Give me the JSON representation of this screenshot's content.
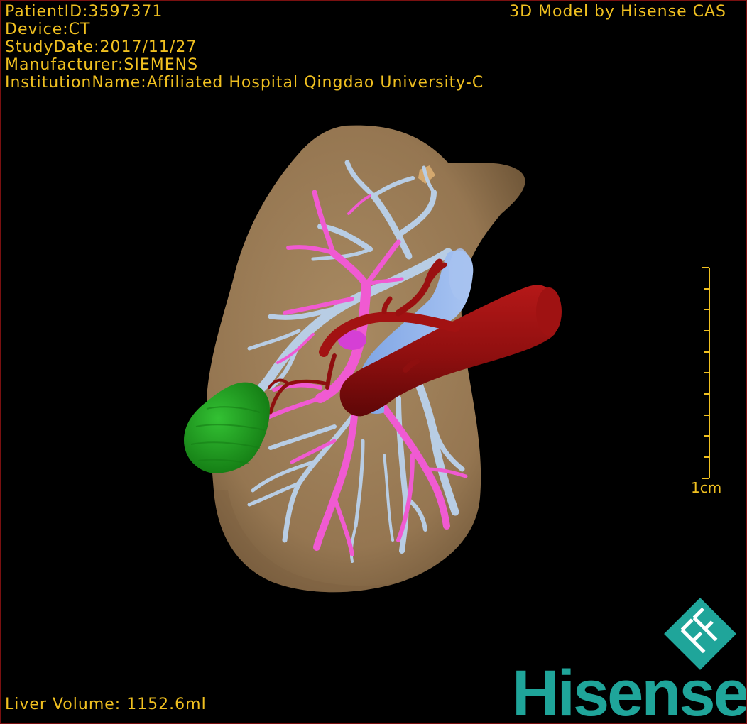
{
  "patient_info": {
    "patient_id": "PatientID:3597371",
    "device": "Device:CT",
    "study_date": "StudyDate:2017/11/27",
    "manufacturer": "Manufacturer:SIEMENS",
    "institution": "InstitutionName:Affiliated Hospital Qingdao University-C"
  },
  "model_credit": "3D Model by Hisense CAS",
  "liver_volume": "Liver Volume: 1152.6ml",
  "scale_bar": {
    "label": "1cm"
  },
  "brand": {
    "wordmark": "Hisense",
    "color": "#1fa59a"
  },
  "colors": {
    "overlay_text": "#f0c020",
    "liver": "#9c7e58",
    "hepatic_vein": "#b8cde4",
    "portal_vein": "#f05ad2",
    "artery": "#8e0f0f",
    "ivc": "#8fb2ea",
    "tumor": "#1f9e1f"
  }
}
